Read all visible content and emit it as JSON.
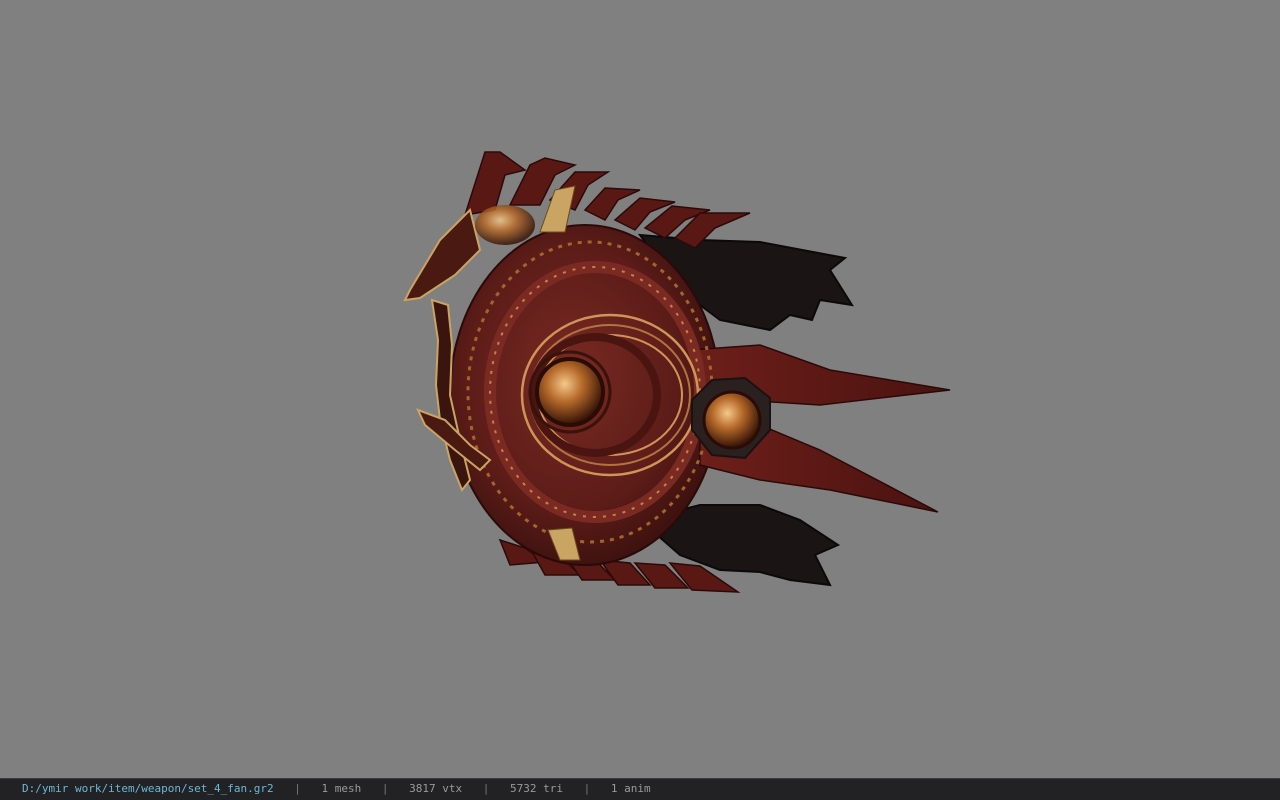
{
  "viewport": {
    "background": "#808080",
    "model_icon": "fan-weapon-model"
  },
  "status_bar": {
    "file_path": "D:/ymir work/item/weapon/set_4_fan.gr2",
    "separator": "|",
    "mesh_count": "1 mesh",
    "vertex_count": "3817 vtx",
    "triangle_count": "5732 tri",
    "anim_count": "1 anim",
    "path_color": "#6ab8d6"
  }
}
